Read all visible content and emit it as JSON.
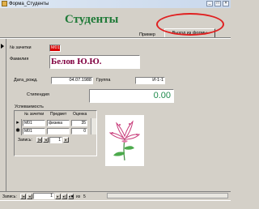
{
  "window": {
    "title": "Форма_Студенты",
    "controls": [
      "_",
      "□",
      "×"
    ]
  },
  "header": {
    "title": "Студенты",
    "example_label": "Пример",
    "exit_button": "Выход из формы"
  },
  "form": {
    "zachetka_label": "№ зачетки",
    "zachetka_value": "М01",
    "familia_label": "Фамилия",
    "familia_value": "Белов Ю.Ю.",
    "birthdate_label": "Дата_рожд.",
    "birthdate_value": "04.07.1988",
    "group_label": "Группа",
    "group_value": "И-1-1",
    "stipend_label": "Стипендия",
    "stipend_value": "0.00"
  },
  "subform": {
    "title": "Успеваемость",
    "columns": [
      "№ зачетки",
      "Предмет",
      "Оценка"
    ],
    "rows": [
      {
        "selector": "▸",
        "cells": [
          "М01",
          "физика",
          "35"
        ]
      },
      {
        "selector": "✱",
        "cells": [
          "М01",
          "",
          "0"
        ]
      }
    ],
    "nav_label": "Запись:",
    "nav_current": "1"
  },
  "bottom_nav": {
    "label": "Запись:",
    "current": "1",
    "of_label": "из",
    "total": "5"
  }
}
